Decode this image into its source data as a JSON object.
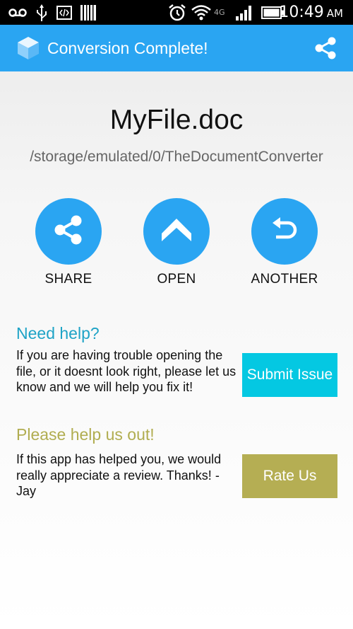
{
  "status_bar": {
    "time": "10:49",
    "ampm": "AM",
    "icons": [
      "voicemail-icon",
      "usb-icon",
      "code-icon",
      "barcode-icon",
      "alarm-icon",
      "wifi-icon",
      "4g-icon",
      "signal-icon",
      "battery-icon"
    ],
    "network_label": "4G"
  },
  "app_bar": {
    "title": "Conversion Complete!",
    "icon": "app-logo-icon",
    "action_icon": "share-icon"
  },
  "file": {
    "name": "MyFile.doc",
    "path": "/storage/emulated/0/TheDocumentConverter"
  },
  "actions": [
    {
      "label": "SHARE",
      "icon": "share-icon"
    },
    {
      "label": "OPEN",
      "icon": "chevron-up-icon"
    },
    {
      "label": "ANOTHER",
      "icon": "undo-icon"
    }
  ],
  "help": {
    "title": "Need help?",
    "body": "If you are having trouble opening the file, or it doesnt look right, please let us know and we will help you fix it!",
    "button": "Submit Issue"
  },
  "rate": {
    "title": "Please help us out!",
    "body": "If this app has helped you, we would really appreciate a review. Thanks! - Jay",
    "button": "Rate Us"
  },
  "colors": {
    "primary": "#2aa5f2",
    "help_title": "#1ea3c6",
    "submit_button": "#04c8e2",
    "rate_title": "#b1ad50",
    "rate_button": "#b5ae53"
  }
}
